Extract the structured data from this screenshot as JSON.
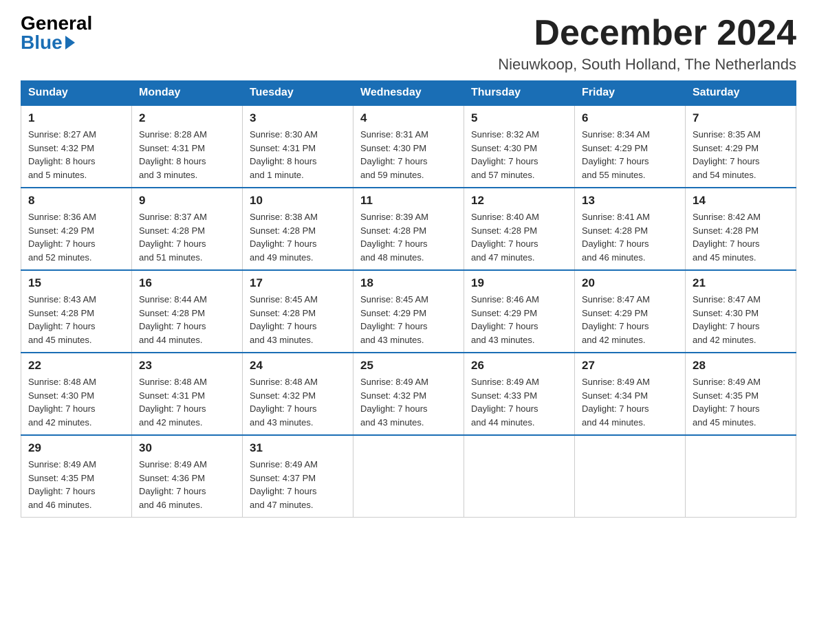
{
  "logo": {
    "general": "General",
    "blue": "Blue"
  },
  "title": "December 2024",
  "location": "Nieuwkoop, South Holland, The Netherlands",
  "days_of_week": [
    "Sunday",
    "Monday",
    "Tuesday",
    "Wednesday",
    "Thursday",
    "Friday",
    "Saturday"
  ],
  "weeks": [
    [
      {
        "day": "1",
        "sunrise": "8:27 AM",
        "sunset": "4:32 PM",
        "daylight": "8 hours and 5 minutes."
      },
      {
        "day": "2",
        "sunrise": "8:28 AM",
        "sunset": "4:31 PM",
        "daylight": "8 hours and 3 minutes."
      },
      {
        "day": "3",
        "sunrise": "8:30 AM",
        "sunset": "4:31 PM",
        "daylight": "8 hours and 1 minute."
      },
      {
        "day": "4",
        "sunrise": "8:31 AM",
        "sunset": "4:30 PM",
        "daylight": "7 hours and 59 minutes."
      },
      {
        "day": "5",
        "sunrise": "8:32 AM",
        "sunset": "4:30 PM",
        "daylight": "7 hours and 57 minutes."
      },
      {
        "day": "6",
        "sunrise": "8:34 AM",
        "sunset": "4:29 PM",
        "daylight": "7 hours and 55 minutes."
      },
      {
        "day": "7",
        "sunrise": "8:35 AM",
        "sunset": "4:29 PM",
        "daylight": "7 hours and 54 minutes."
      }
    ],
    [
      {
        "day": "8",
        "sunrise": "8:36 AM",
        "sunset": "4:29 PM",
        "daylight": "7 hours and 52 minutes."
      },
      {
        "day": "9",
        "sunrise": "8:37 AM",
        "sunset": "4:28 PM",
        "daylight": "7 hours and 51 minutes."
      },
      {
        "day": "10",
        "sunrise": "8:38 AM",
        "sunset": "4:28 PM",
        "daylight": "7 hours and 49 minutes."
      },
      {
        "day": "11",
        "sunrise": "8:39 AM",
        "sunset": "4:28 PM",
        "daylight": "7 hours and 48 minutes."
      },
      {
        "day": "12",
        "sunrise": "8:40 AM",
        "sunset": "4:28 PM",
        "daylight": "7 hours and 47 minutes."
      },
      {
        "day": "13",
        "sunrise": "8:41 AM",
        "sunset": "4:28 PM",
        "daylight": "7 hours and 46 minutes."
      },
      {
        "day": "14",
        "sunrise": "8:42 AM",
        "sunset": "4:28 PM",
        "daylight": "7 hours and 45 minutes."
      }
    ],
    [
      {
        "day": "15",
        "sunrise": "8:43 AM",
        "sunset": "4:28 PM",
        "daylight": "7 hours and 45 minutes."
      },
      {
        "day": "16",
        "sunrise": "8:44 AM",
        "sunset": "4:28 PM",
        "daylight": "7 hours and 44 minutes."
      },
      {
        "day": "17",
        "sunrise": "8:45 AM",
        "sunset": "4:28 PM",
        "daylight": "7 hours and 43 minutes."
      },
      {
        "day": "18",
        "sunrise": "8:45 AM",
        "sunset": "4:29 PM",
        "daylight": "7 hours and 43 minutes."
      },
      {
        "day": "19",
        "sunrise": "8:46 AM",
        "sunset": "4:29 PM",
        "daylight": "7 hours and 43 minutes."
      },
      {
        "day": "20",
        "sunrise": "8:47 AM",
        "sunset": "4:29 PM",
        "daylight": "7 hours and 42 minutes."
      },
      {
        "day": "21",
        "sunrise": "8:47 AM",
        "sunset": "4:30 PM",
        "daylight": "7 hours and 42 minutes."
      }
    ],
    [
      {
        "day": "22",
        "sunrise": "8:48 AM",
        "sunset": "4:30 PM",
        "daylight": "7 hours and 42 minutes."
      },
      {
        "day": "23",
        "sunrise": "8:48 AM",
        "sunset": "4:31 PM",
        "daylight": "7 hours and 42 minutes."
      },
      {
        "day": "24",
        "sunrise": "8:48 AM",
        "sunset": "4:32 PM",
        "daylight": "7 hours and 43 minutes."
      },
      {
        "day": "25",
        "sunrise": "8:49 AM",
        "sunset": "4:32 PM",
        "daylight": "7 hours and 43 minutes."
      },
      {
        "day": "26",
        "sunrise": "8:49 AM",
        "sunset": "4:33 PM",
        "daylight": "7 hours and 44 minutes."
      },
      {
        "day": "27",
        "sunrise": "8:49 AM",
        "sunset": "4:34 PM",
        "daylight": "7 hours and 44 minutes."
      },
      {
        "day": "28",
        "sunrise": "8:49 AM",
        "sunset": "4:35 PM",
        "daylight": "7 hours and 45 minutes."
      }
    ],
    [
      {
        "day": "29",
        "sunrise": "8:49 AM",
        "sunset": "4:35 PM",
        "daylight": "7 hours and 46 minutes."
      },
      {
        "day": "30",
        "sunrise": "8:49 AM",
        "sunset": "4:36 PM",
        "daylight": "7 hours and 46 minutes."
      },
      {
        "day": "31",
        "sunrise": "8:49 AM",
        "sunset": "4:37 PM",
        "daylight": "7 hours and 47 minutes."
      },
      null,
      null,
      null,
      null
    ]
  ],
  "labels": {
    "sunrise": "Sunrise:",
    "sunset": "Sunset:",
    "daylight": "Daylight:"
  }
}
